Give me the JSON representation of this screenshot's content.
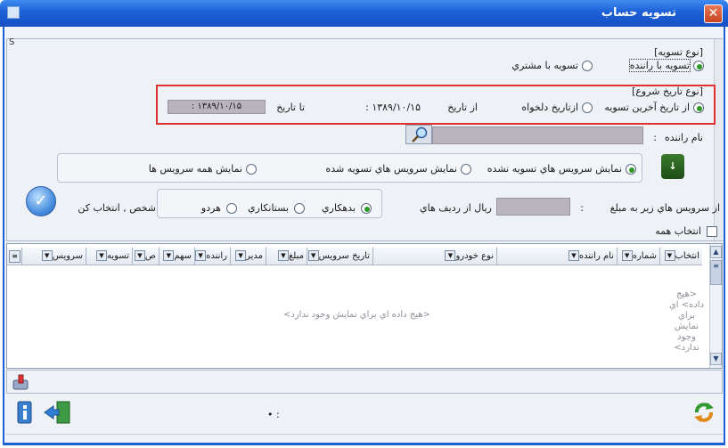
{
  "window": {
    "title": "تسویه حساب",
    "close_label": "✕"
  },
  "panel": {
    "label": "S"
  },
  "settlement_type": {
    "heading": "[نوع تسويه]",
    "options": [
      {
        "label": "تسويه با راننده",
        "selected": true
      },
      {
        "label": "تسويه با مشتري",
        "selected": false
      }
    ]
  },
  "start_date_type": {
    "heading": "[نوع تاريخ شروع]",
    "options": [
      {
        "label": "از تاريخ آخرين تسويه",
        "selected": true
      },
      {
        "label": "ازتاريخ دلخواه",
        "selected": false
      }
    ],
    "from_label": "از تاريخ",
    "from_value": "۱۳۸۹/۱۰/۱۵ :",
    "to_label": "تا تاريخ",
    "to_value": "۱۳۸۹/۱۰/۱۵ :"
  },
  "driver": {
    "label": "نام راننده",
    "colon": ":",
    "value": ""
  },
  "service_filter": {
    "options": [
      {
        "label": "نمايش سرويس هاي تسويه نشده",
        "selected": true
      },
      {
        "label": "نمايش سرويس هاي تسويه شده",
        "selected": false
      },
      {
        "label": "نمايش همه سرويس ها",
        "selected": false
      }
    ]
  },
  "amount_filter": {
    "prefix": "از سرويس هاي زير به مبلغ",
    "colon": ":",
    "suffix": "ريال از رديف هاي",
    "value": "",
    "options": [
      {
        "label": "بدهكاري",
        "selected": true
      },
      {
        "label": "بستانكاري",
        "selected": false
      },
      {
        "label": "هردو",
        "selected": false
      }
    ],
    "tail": "شخص , انتخاب كن"
  },
  "select_all": {
    "label": "انتخاب همه",
    "checked": false
  },
  "grid": {
    "columns": [
      "انتخاب",
      "شماره",
      "نام راننده",
      "نوع خودرو",
      "تاريخ سرويس",
      "مبلغ",
      "مدير",
      "راننده",
      "سهم",
      "ص",
      "تسويه",
      "سرويس"
    ],
    "empty_message": "<هيج داده اي براي نمايش وجود ندارد>",
    "side_empty_message": "<هيج داده> اي براي نمايش وجود ندارد>"
  },
  "footer": {
    "status": "• :"
  },
  "icons": {
    "search": "search-icon",
    "apply": "check-circle-icon",
    "download": "download-icon",
    "attach": "attach-icon",
    "exit": "exit-door-icon",
    "refresh": "refresh-icon"
  },
  "colors": {
    "titlebar": "#1d5fd6",
    "highlight_border": "#e03030",
    "radio_selected": "#2d9a27",
    "field_fill": "#b9b4be",
    "empty_text": "#8f8f9c"
  }
}
